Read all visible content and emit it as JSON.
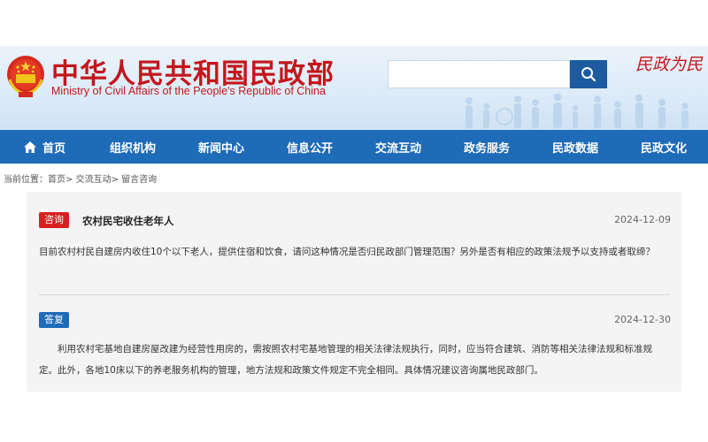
{
  "header": {
    "title_cn": "中华人民共和国民政部",
    "title_en": "Ministry of Civil Affairs of the People's Republic of China",
    "search": {
      "placeholder": "",
      "value": ""
    },
    "calligraphy": "民政为民 民",
    "brand_color": "#c4161c"
  },
  "nav": {
    "items": [
      {
        "label": "首页",
        "icon": "home-icon"
      },
      {
        "label": "组织机构"
      },
      {
        "label": "新闻中心"
      },
      {
        "label": "信息公开"
      },
      {
        "label": "交流互动"
      },
      {
        "label": "政务服务"
      },
      {
        "label": "民政数据"
      },
      {
        "label": "民政文化"
      }
    ],
    "color": "#1e6bb8"
  },
  "breadcrumb": {
    "prefix": "当前位置：",
    "items": [
      "首页",
      "交流互动",
      "留言咨询"
    ],
    "separator": ">"
  },
  "consult": {
    "question": {
      "tag": "咨询",
      "title": "农村民宅收住老年人",
      "date": "2024-12-09",
      "body": "目前农村村民自建房内收住10个以下老人，提供住宿和饮食，请问这种情况是否归民政部门管理范围？另外是否有相应的政策法规予以支持或者取缔？"
    },
    "reply": {
      "tag": "答复",
      "date": "2024-12-30",
      "body": "利用农村宅基地自建房屋改建为经营性用房的，需按照农村宅基地管理的相关法律法规执行，同时，应当符合建筑、消防等相关法律法规和标准规定。此外，各地10床以下的养老服务机构的管理，地方法规和政策文件规定不完全相同。具体情况建议咨询属地民政部门。"
    }
  }
}
